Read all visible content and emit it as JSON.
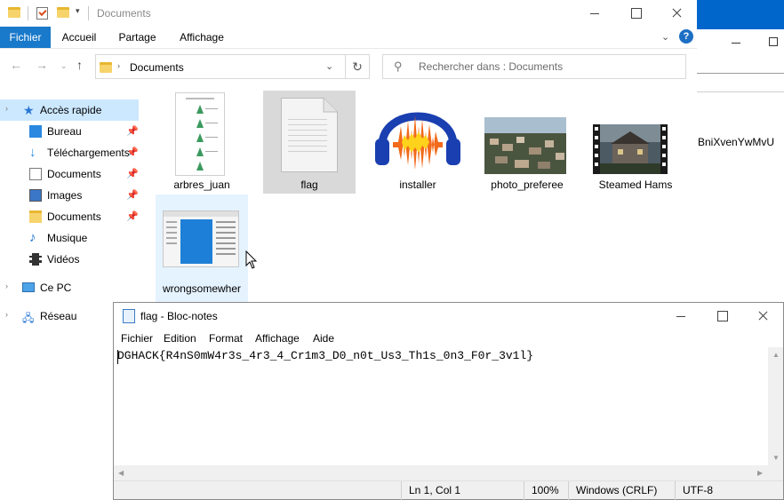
{
  "explorer": {
    "title": "Documents",
    "ribbon_tabs": [
      "Fichier",
      "Accueil",
      "Partage",
      "Affichage"
    ],
    "help": "?",
    "address": "Documents",
    "search_placeholder": "Rechercher dans : Documents",
    "sidebar": [
      {
        "label": "Accès rapide",
        "icon": "star-icon",
        "pinned": false,
        "selected": true
      },
      {
        "label": "Bureau",
        "icon": "desktop-icon",
        "pinned": true
      },
      {
        "label": "Téléchargements",
        "icon": "download-icon",
        "pinned": true
      },
      {
        "label": "Documents",
        "icon": "documents-icon",
        "pinned": true
      },
      {
        "label": "Images",
        "icon": "images-icon",
        "pinned": true
      },
      {
        "label": "Documents",
        "icon": "folder-icon",
        "pinned": true
      },
      {
        "label": "Musique",
        "icon": "music-icon",
        "pinned": false
      },
      {
        "label": "Vidéos",
        "icon": "video-icon",
        "pinned": false
      },
      {
        "label": "Ce PC",
        "icon": "computer-icon",
        "pinned": false
      },
      {
        "label": "Réseau",
        "icon": "network-icon",
        "pinned": false
      }
    ],
    "files": [
      {
        "name": "arbres_juan",
        "icon": "document-thumbnail-icon"
      },
      {
        "name": "flag",
        "icon": "text-file-icon"
      },
      {
        "name": "installer",
        "icon": "audacity-icon"
      },
      {
        "name": "photo_preferee",
        "icon": "photo-thumbnail-icon"
      },
      {
        "name": "Steamed Hams",
        "icon": "video-thumbnail-icon"
      },
      {
        "name": "wrongsomewher",
        "icon": "window-thumbnail-icon"
      }
    ]
  },
  "background_window": {
    "text": "BniXvenYwMvU",
    "accent_color": "#0066cc"
  },
  "notepad": {
    "title": "flag - Bloc-notes",
    "menu": [
      "Fichier",
      "Edition",
      "Format",
      "Affichage",
      "Aide"
    ],
    "content": "DGHACK{R4nS0mW4r3s_4r3_4_Cr1m3_D0_n0t_Us3_Th1s_0n3_F0r_3v1l}",
    "status": {
      "position": "Ln 1, Col 1",
      "zoom": "100%",
      "line_ending": "Windows (CRLF)",
      "encoding": "UTF-8"
    }
  },
  "colors": {
    "file_tab": "#1979ca",
    "selection": "#cce8ff",
    "selected_tile": "#d9d9d9"
  }
}
